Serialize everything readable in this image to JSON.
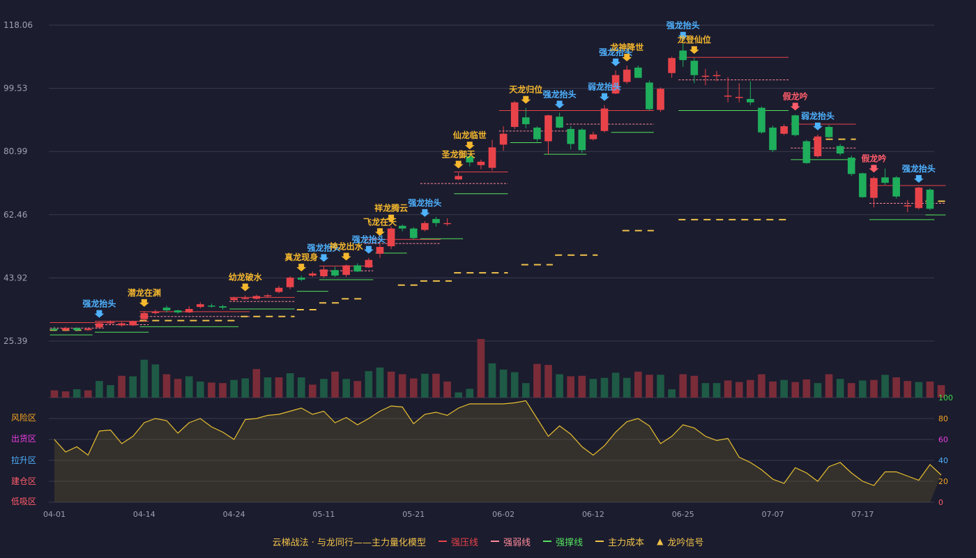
{
  "colors": {
    "background": "#1b1c2e",
    "grid": "#3a3b4e",
    "axis_text": "#a0a0b0",
    "up": "#e9434a",
    "down": "#1fae5c",
    "weak_line": "#ff8a9a",
    "support": "#54e15d",
    "cost": "#f0c24a",
    "signal_gold": "#f5b82e",
    "signal_blue": "#4fb2ff",
    "signal_red": "#ff5c6a",
    "line_yellow": "#e8c030",
    "right_axis_green": "#3ddc4a",
    "right_axis_orange": "#f5a623"
  },
  "chart_data": {
    "type": "candlestick",
    "price_axis": {
      "ticks": [
        "118.06",
        "99.53",
        "80.99",
        "62.46",
        "43.92",
        "25.39"
      ],
      "min": 25.39,
      "max": 118.06
    },
    "x_ticks": [
      {
        "label": "04-01",
        "index": 0
      },
      {
        "label": "04-14",
        "index": 8
      },
      {
        "label": "04-24",
        "index": 16
      },
      {
        "label": "05-11",
        "index": 24
      },
      {
        "label": "05-21",
        "index": 32
      },
      {
        "label": "06-02",
        "index": 40
      },
      {
        "label": "06-12",
        "index": 48
      },
      {
        "label": "06-25",
        "index": 56
      },
      {
        "label": "07-07",
        "index": 64
      },
      {
        "label": "07-17",
        "index": 72
      }
    ],
    "candles": [
      [
        29.0,
        28.6,
        29.6,
        28.2
      ],
      [
        28.6,
        29.2,
        29.6,
        28.2
      ],
      [
        29.2,
        28.6,
        29.4,
        28.2
      ],
      [
        28.6,
        29.0,
        29.4,
        28.4
      ],
      [
        29.4,
        30.6,
        31.0,
        29.2
      ],
      [
        30.6,
        31.0,
        31.4,
        30.2
      ],
      [
        30.0,
        30.6,
        31.0,
        29.6
      ],
      [
        30.0,
        31.2,
        31.4,
        29.8
      ],
      [
        31.8,
        33.6,
        34.2,
        31.2
      ],
      [
        33.6,
        34.0,
        34.6,
        33.2
      ],
      [
        35.2,
        34.4,
        35.8,
        33.8
      ],
      [
        34.4,
        33.8,
        34.6,
        33.4
      ],
      [
        33.8,
        34.8,
        35.6,
        33.6
      ],
      [
        35.4,
        36.2,
        36.8,
        35.0
      ],
      [
        35.8,
        35.6,
        36.4,
        35.2
      ],
      [
        35.6,
        35.2,
        36.0,
        34.6
      ],
      [
        37.4,
        38.0,
        38.4,
        37.0
      ],
      [
        37.8,
        38.0,
        38.8,
        37.6
      ],
      [
        37.8,
        38.6,
        39.0,
        37.6
      ],
      [
        38.6,
        38.8,
        39.2,
        38.2
      ],
      [
        39.8,
        41.0,
        41.6,
        39.4
      ],
      [
        41.2,
        44.0,
        44.4,
        40.6
      ],
      [
        44.0,
        43.4,
        44.6,
        43.0
      ],
      [
        44.6,
        45.2,
        45.8,
        44.2
      ],
      [
        44.4,
        46.4,
        47.4,
        44.0
      ],
      [
        46.2,
        44.6,
        47.2,
        44.2
      ],
      [
        44.8,
        47.6,
        47.8,
        44.2
      ],
      [
        47.6,
        45.8,
        48.2,
        45.6
      ],
      [
        47.0,
        49.2,
        49.8,
        46.8
      ],
      [
        51.0,
        53.0,
        55.0,
        49.8
      ],
      [
        53.2,
        58.4,
        59.0,
        52.4
      ],
      [
        59.2,
        58.4,
        59.6,
        57.6
      ],
      [
        58.4,
        55.6,
        58.8,
        55.2
      ],
      [
        58.0,
        60.0,
        60.6,
        57.6
      ],
      [
        61.2,
        60.0,
        61.8,
        59.0
      ],
      [
        60.0,
        60.0,
        61.4,
        59.2
      ],
      [
        72.8,
        73.8,
        74.8,
        72.6
      ],
      [
        79.6,
        77.8,
        80.4,
        76.6
      ],
      [
        77.0,
        78.0,
        78.6,
        75.8
      ],
      [
        76.2,
        82.2,
        84.4,
        75.4
      ],
      [
        83.0,
        86.2,
        88.4,
        81.2
      ],
      [
        88.2,
        95.4,
        95.8,
        87.6
      ],
      [
        91.0,
        89.0,
        93.8,
        87.8
      ],
      [
        88.0,
        84.6,
        88.4,
        83.8
      ],
      [
        84.0,
        91.6,
        91.8,
        80.2
      ],
      [
        91.2,
        88.0,
        92.4,
        87.8
      ],
      [
        87.6,
        83.2,
        88.4,
        81.6
      ],
      [
        87.4,
        81.4,
        87.8,
        80.6
      ],
      [
        84.6,
        86.0,
        86.8,
        84.2
      ],
      [
        87.0,
        93.6,
        94.6,
        86.6
      ],
      [
        98.0,
        103.4,
        104.8,
        97.8
      ],
      [
        101.4,
        105.0,
        106.2,
        100.8
      ],
      [
        105.6,
        102.6,
        106.2,
        102.6
      ],
      [
        101.2,
        93.4,
        101.8,
        93.0
      ],
      [
        93.2,
        99.4,
        99.8,
        92.6
      ],
      [
        104.0,
        108.4,
        108.8,
        102.6
      ],
      [
        110.6,
        107.8,
        112.6,
        105.8
      ],
      [
        107.6,
        103.4,
        108.4,
        101.0
      ],
      [
        103.2,
        103.2,
        105.2,
        100.4
      ],
      [
        103.4,
        103.4,
        104.6,
        101.6
      ],
      [
        97.4,
        97.4,
        102.8,
        95.4
      ],
      [
        97.0,
        97.0,
        101.0,
        95.4
      ],
      [
        96.4,
        95.4,
        101.6,
        94.6
      ],
      [
        93.8,
        86.6,
        94.2,
        86.2
      ],
      [
        88.0,
        81.4,
        88.6,
        80.8
      ],
      [
        86.2,
        88.4,
        89.0,
        85.8
      ],
      [
        91.6,
        85.8,
        91.8,
        85.4
      ],
      [
        84.0,
        77.6,
        84.4,
        77.4
      ],
      [
        79.6,
        85.4,
        86.0,
        79.2
      ],
      [
        88.2,
        85.2,
        88.8,
        85.0
      ],
      [
        82.6,
        80.4,
        83.2,
        79.8
      ],
      [
        79.2,
        74.4,
        79.8,
        73.8
      ],
      [
        74.6,
        67.6,
        74.8,
        67.4
      ],
      [
        67.4,
        73.2,
        73.6,
        64.6
      ],
      [
        73.4,
        71.8,
        76.0,
        71.2
      ],
      [
        73.4,
        67.8,
        73.8,
        67.2
      ],
      [
        65.2,
        65.2,
        66.8,
        63.2
      ],
      [
        64.4,
        70.4,
        70.6,
        64.0
      ],
      [
        69.8,
        64.2,
        70.2,
        63.8
      ]
    ],
    "volumes": [
      [
        14,
        1
      ],
      [
        12,
        1
      ],
      [
        16,
        0
      ],
      [
        14,
        1
      ],
      [
        32,
        0
      ],
      [
        24,
        0
      ],
      [
        42,
        1
      ],
      [
        41,
        0
      ],
      [
        73,
        0
      ],
      [
        64,
        0
      ],
      [
        45,
        1
      ],
      [
        36,
        1
      ],
      [
        41,
        0
      ],
      [
        31,
        0
      ],
      [
        29,
        1
      ],
      [
        28,
        1
      ],
      [
        34,
        0
      ],
      [
        37,
        0
      ],
      [
        55,
        1
      ],
      [
        39,
        0
      ],
      [
        39,
        1
      ],
      [
        47,
        0
      ],
      [
        39,
        0
      ],
      [
        25,
        1
      ],
      [
        36,
        0
      ],
      [
        50,
        1
      ],
      [
        36,
        0
      ],
      [
        32,
        1
      ],
      [
        51,
        0
      ],
      [
        58,
        0
      ],
      [
        50,
        1
      ],
      [
        45,
        1
      ],
      [
        37,
        1
      ],
      [
        46,
        0
      ],
      [
        46,
        1
      ],
      [
        31,
        1
      ],
      [
        10,
        0
      ],
      [
        17,
        0
      ],
      [
        113,
        1
      ],
      [
        66,
        0
      ],
      [
        54,
        0
      ],
      [
        49,
        0
      ],
      [
        28,
        0
      ],
      [
        65,
        1
      ],
      [
        63,
        1
      ],
      [
        45,
        0
      ],
      [
        41,
        1
      ],
      [
        42,
        1
      ],
      [
        36,
        0
      ],
      [
        38,
        0
      ],
      [
        48,
        0
      ],
      [
        38,
        0
      ],
      [
        50,
        1
      ],
      [
        44,
        1
      ],
      [
        44,
        0
      ],
      [
        16,
        0
      ],
      [
        45,
        1
      ],
      [
        42,
        1
      ],
      [
        28,
        0
      ],
      [
        28,
        0
      ],
      [
        33,
        1
      ],
      [
        30,
        1
      ],
      [
        34,
        1
      ],
      [
        45,
        1
      ],
      [
        31,
        1
      ],
      [
        34,
        0
      ],
      [
        30,
        1
      ],
      [
        35,
        1
      ],
      [
        28,
        0
      ],
      [
        45,
        1
      ],
      [
        36,
        0
      ],
      [
        28,
        1
      ],
      [
        33,
        0
      ],
      [
        34,
        1
      ],
      [
        44,
        0
      ],
      [
        39,
        1
      ],
      [
        32,
        1
      ],
      [
        30,
        0
      ],
      [
        31,
        1
      ],
      [
        24,
        1
      ]
    ],
    "oscillator": [
      60,
      48,
      53,
      45,
      68,
      69,
      56,
      63,
      76,
      80,
      78,
      66,
      76,
      80,
      72,
      67,
      60,
      79,
      80,
      83,
      84,
      87,
      90,
      84,
      87,
      76,
      81,
      74,
      80,
      87,
      92,
      91,
      75,
      84,
      86,
      83,
      90,
      94,
      94,
      94,
      94,
      95,
      97,
      80,
      63,
      73,
      65,
      53,
      45,
      54,
      67,
      77,
      80,
      73,
      56,
      63,
      74,
      71,
      63,
      59,
      61,
      43,
      38,
      31,
      22,
      18,
      33,
      28,
      20,
      34,
      38,
      28,
      20,
      16,
      29,
      29,
      25,
      21,
      36,
      26
    ],
    "oscillator_axis": {
      "ticks": [
        "100",
        "80",
        "60",
        "40",
        "20",
        "0"
      ],
      "min": 0,
      "max": 100
    },
    "zones": [
      "风险区",
      "出货区",
      "拉升区",
      "建仓区",
      "低吸区"
    ],
    "zone_colors": [
      "#f5a623",
      "#e83ee0",
      "#4fb2ff",
      "#ff5c6a",
      "#ff5c6a"
    ],
    "right_axis_colors": [
      "#3ddc4a",
      "#f5a623",
      "#e83ee0",
      "#4fb2ff",
      "#f5a623",
      "#ff5c6a"
    ],
    "signals": [
      {
        "index": 4,
        "text": "强龙抬头",
        "color": "blue",
        "position": "above"
      },
      {
        "index": 8,
        "text": "潜龙在渊",
        "color": "gold",
        "position": "above"
      },
      {
        "index": 17,
        "text": "幼龙破水",
        "color": "gold",
        "position": "above"
      },
      {
        "index": 22,
        "text": "真龙现身",
        "color": "gold",
        "position": "above"
      },
      {
        "index": 24,
        "text": "强龙抬头",
        "color": "blue",
        "position": "above"
      },
      {
        "index": 26,
        "text": "神龙出水",
        "color": "gold",
        "position": "above"
      },
      {
        "index": 28,
        "text": "强龙抬头",
        "color": "blue",
        "position": "above"
      },
      {
        "index": 29,
        "text": "飞龙在天",
        "color": "gold",
        "position": "above"
      },
      {
        "index": 30,
        "text": "祥龙腾云",
        "color": "gold",
        "position": "above"
      },
      {
        "index": 33,
        "text": "强龙抬头",
        "color": "blue",
        "position": "above"
      },
      {
        "index": 36,
        "text": "圣龙御天",
        "color": "gold",
        "position": "above"
      },
      {
        "index": 37,
        "text": "仙龙临世",
        "color": "gold",
        "position": "above"
      },
      {
        "index": 42,
        "text": "天龙归位",
        "color": "gold",
        "position": "above"
      },
      {
        "index": 45,
        "text": "强龙抬头",
        "color": "blue",
        "position": "above"
      },
      {
        "index": 49,
        "text": "弱龙抬头",
        "color": "blue",
        "position": "above"
      },
      {
        "index": 50,
        "text": "强龙抬头",
        "color": "blue",
        "position": "above"
      },
      {
        "index": 51,
        "text": "龙神降世",
        "color": "gold",
        "position": "above"
      },
      {
        "index": 56,
        "text": "强龙抬头",
        "color": "blue",
        "position": "above"
      },
      {
        "index": 57,
        "text": "龙登仙位",
        "color": "gold",
        "position": "above"
      },
      {
        "index": 66,
        "text": "假龙吟",
        "color": "red",
        "position": "above"
      },
      {
        "index": 68,
        "text": "弱龙抬头",
        "color": "blue",
        "position": "above"
      },
      {
        "index": 73,
        "text": "假龙吟",
        "color": "red",
        "position": "above"
      },
      {
        "index": 77,
        "text": "强龙抬头",
        "color": "blue",
        "position": "above"
      }
    ],
    "pressure_lines": [
      [
        0,
        5,
        30.8
      ],
      [
        4,
        8,
        31.2
      ],
      [
        8,
        17,
        34.0
      ],
      [
        16,
        21,
        38.2
      ],
      [
        24,
        28,
        47.4
      ],
      [
        28,
        34,
        55.2
      ],
      [
        36,
        40,
        75.0
      ],
      [
        40,
        46,
        93.0
      ],
      [
        46,
        53,
        93.0
      ],
      [
        56,
        65,
        108.6
      ],
      [
        66,
        71,
        89.0
      ],
      [
        73,
        79,
        71.0
      ]
    ],
    "weak_lines": [
      [
        0,
        4,
        29.2
      ],
      [
        4,
        8,
        30.2
      ],
      [
        8,
        17,
        32.6
      ],
      [
        16,
        21,
        37.0
      ],
      [
        24,
        28,
        46.0
      ],
      [
        28,
        34,
        54.0
      ],
      [
        33,
        40,
        71.6
      ],
      [
        40,
        46,
        87.0
      ],
      [
        46,
        53,
        89.0
      ],
      [
        56,
        65,
        102.0
      ],
      [
        66,
        71,
        82.0
      ],
      [
        73,
        79,
        65.8
      ]
    ],
    "support_lines": [
      [
        0,
        3,
        27.2
      ],
      [
        4,
        8,
        28.0
      ],
      [
        8,
        16,
        29.6
      ],
      [
        16,
        21,
        34.8
      ],
      [
        22,
        24,
        40.0
      ],
      [
        24,
        28,
        43.4
      ],
      [
        29,
        31,
        51.2
      ],
      [
        33,
        36,
        55.4
      ],
      [
        36,
        40,
        68.6
      ],
      [
        41,
        43,
        83.6
      ],
      [
        44,
        47,
        80.2
      ],
      [
        50,
        53,
        86.6
      ],
      [
        56,
        65,
        93.0
      ],
      [
        66,
        71,
        78.6
      ],
      [
        73,
        78,
        61.0
      ],
      [
        78,
        79,
        62.4
      ]
    ],
    "cost_segments": [
      [
        0,
        2,
        28.6
      ],
      [
        8,
        16,
        31.4
      ],
      [
        17,
        21,
        32.6
      ],
      [
        22,
        23,
        34.6
      ],
      [
        24,
        25,
        36.6
      ],
      [
        26,
        27,
        37.8
      ],
      [
        31,
        32,
        41.8
      ],
      [
        33,
        35,
        43.0
      ],
      [
        36,
        40,
        45.4
      ],
      [
        42,
        44,
        47.8
      ],
      [
        45,
        48,
        50.6
      ],
      [
        51,
        53,
        57.8
      ],
      [
        56,
        65,
        61.0
      ],
      [
        68,
        71,
        84.6
      ],
      [
        78,
        79,
        66.4
      ]
    ]
  },
  "legend": {
    "title": "云梯战法 · 与龙同行——主力量化模型",
    "items": [
      {
        "label": "强压线",
        "color": "#e9434a",
        "style": "solid"
      },
      {
        "label": "强弱线",
        "color": "#ff8a9a",
        "style": "dash"
      },
      {
        "label": "强撑线",
        "color": "#54e15d",
        "style": "solid"
      },
      {
        "label": "主力成本",
        "color": "#f0c24a",
        "style": "dash"
      }
    ],
    "signal_label": "龙吟信号",
    "signal_icon": "triangle-icon"
  }
}
